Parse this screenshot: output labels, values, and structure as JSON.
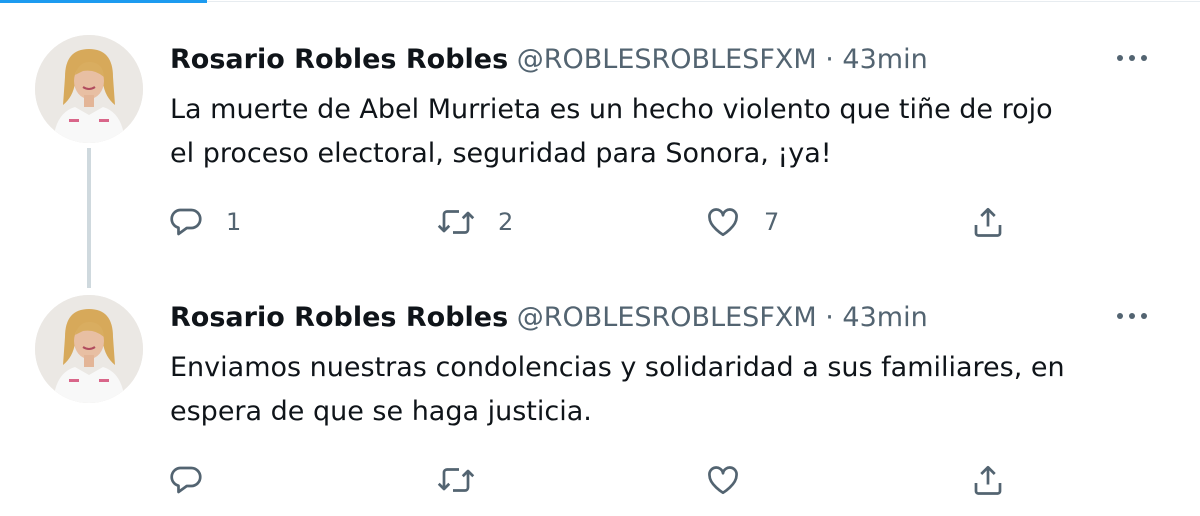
{
  "colors": {
    "accent": "#1d9bf0",
    "text_primary": "#0f1419",
    "text_secondary": "#536471",
    "thread_line": "#cfd9de"
  },
  "tweets": [
    {
      "author_name": "Rosario Robles Robles",
      "handle": "@ROBLESROBLESFXM",
      "separator": "·",
      "time": "43min",
      "text_lines": [
        "La muerte de Abel Murrieta es un hecho violento que tiñe de rojo",
        "el proceso electoral, seguridad para Sonora, ¡ya!"
      ],
      "reply_count": "1",
      "retweet_count": "2",
      "like_count": "7",
      "icons": {
        "more": "more-options-icon",
        "reply": "reply-icon",
        "retweet": "retweet-icon",
        "like": "heart-icon",
        "share": "share-icon"
      }
    },
    {
      "author_name": "Rosario Robles Robles",
      "handle": "@ROBLESROBLESFXM",
      "separator": "·",
      "time": "43min",
      "text_lines": [
        "Enviamos nuestras condolencias y solidaridad a sus familiares, en",
        "espera de que se haga justicia."
      ],
      "reply_count": "",
      "retweet_count": "",
      "like_count": "",
      "icons": {
        "more": "more-options-icon",
        "reply": "reply-icon",
        "retweet": "retweet-icon",
        "like": "heart-icon",
        "share": "share-icon"
      }
    }
  ]
}
